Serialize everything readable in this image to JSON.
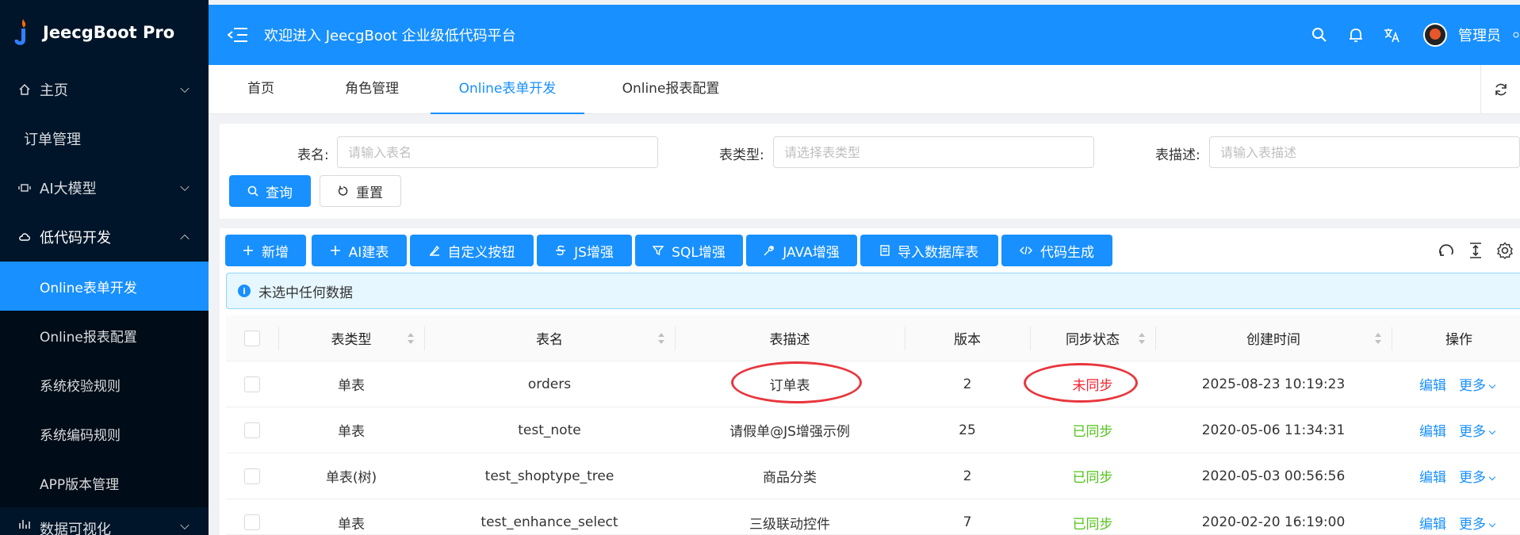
{
  "app": {
    "title": "JeecgBoot Pro"
  },
  "colors": {
    "primary": "#1890ff",
    "sidebar": "#001529",
    "danger": "#f5222d",
    "success": "#52c41a",
    "highlight": "#e8363c"
  },
  "sidebar": {
    "items": [
      {
        "label": "主页",
        "icon": "home-icon",
        "expandable": true
      },
      {
        "label": "订单管理"
      },
      {
        "label": "AI大模型",
        "icon": "ai-model-icon",
        "expandable": true
      },
      {
        "label": "低代码开发",
        "icon": "cloud-icon",
        "expandable": true,
        "expanded": true
      }
    ],
    "subitems": [
      "Online表单开发",
      "Online报表配置",
      "系统校验规则",
      "系统编码规则",
      "APP版本管理"
    ],
    "bottom_item": {
      "label": "数据可视化",
      "icon": "chart-icon"
    }
  },
  "header": {
    "welcome": "欢迎进入 JeecgBoot 企业级低代码平台",
    "username": "管理员",
    "icons": [
      "search-icon",
      "bell-icon",
      "translate-icon"
    ]
  },
  "tabs": [
    "首页",
    "角色管理",
    "Online表单开发",
    "Online报表配置"
  ],
  "active_tab": "Online表单开发",
  "search": {
    "table_name_label": "表名:",
    "table_name_placeholder": "请输入表名",
    "table_type_label": "表类型:",
    "table_type_placeholder": "请选择表类型",
    "table_desc_label": "表描述:",
    "table_desc_placeholder": "请输入表描述",
    "query_label": "查询",
    "reset_label": "重置"
  },
  "toolbar": {
    "buttons": [
      "新增",
      "AI建表",
      "自定义按钮",
      "JS增强",
      "SQL增强",
      "JAVA增强",
      "导入数据库表",
      "代码生成"
    ]
  },
  "alert": {
    "text": "未选中任何数据"
  },
  "table": {
    "columns": [
      "表类型",
      "表名",
      "表描述",
      "版本",
      "同步状态",
      "创建时间",
      "操作"
    ],
    "rows": [
      {
        "type": "单表",
        "name": "orders",
        "desc": "订单表",
        "version": "2",
        "sync": "未同步",
        "synced": false,
        "created": "2025-08-23 10:19:23"
      },
      {
        "type": "单表",
        "name": "test_note",
        "desc": "请假单@JS增强示例",
        "version": "25",
        "sync": "已同步",
        "synced": true,
        "created": "2020-05-06 11:34:31"
      },
      {
        "type": "单表(树)",
        "name": "test_shoptype_tree",
        "desc": "商品分类",
        "version": "2",
        "sync": "已同步",
        "synced": true,
        "created": "2020-05-03 00:56:56"
      },
      {
        "type": "单表",
        "name": "test_enhance_select",
        "desc": "三级联动控件",
        "version": "7",
        "sync": "已同步",
        "synced": true,
        "created": "2020-02-20 16:19:00"
      }
    ],
    "actions": {
      "edit": "编辑",
      "more": "更多"
    }
  }
}
